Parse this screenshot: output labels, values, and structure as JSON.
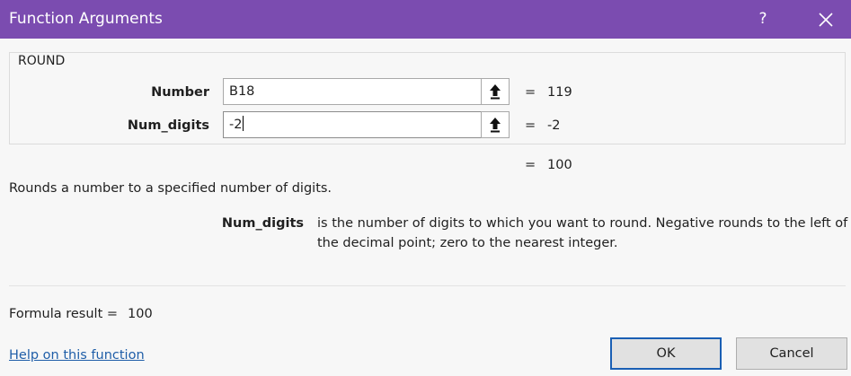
{
  "window": {
    "title": "Function Arguments",
    "help_label": "?",
    "close_icon": "close-icon"
  },
  "function": {
    "name": "ROUND",
    "arguments": [
      {
        "label": "Number",
        "value": "B18",
        "result_eq": "=",
        "result": "119"
      },
      {
        "label": "Num_digits",
        "value": "-2",
        "result_eq": "=",
        "result": "-2"
      }
    ],
    "total_eq": "=",
    "total_result": "100",
    "description": "Rounds a number to a specified number of digits.",
    "arg_help": {
      "name": "Num_digits",
      "text": "is the number of digits to which you want to round. Negative rounds to the left of the decimal point; zero to the nearest integer."
    }
  },
  "footer": {
    "formula_result_label": "Formula result =",
    "formula_result_value": "100",
    "help_link": "Help on this function",
    "ok_label": "OK",
    "cancel_label": "Cancel"
  },
  "colors": {
    "titlebar": "#7b4cb0",
    "link": "#1f5ea8",
    "ok_border": "#1a5fb4"
  }
}
